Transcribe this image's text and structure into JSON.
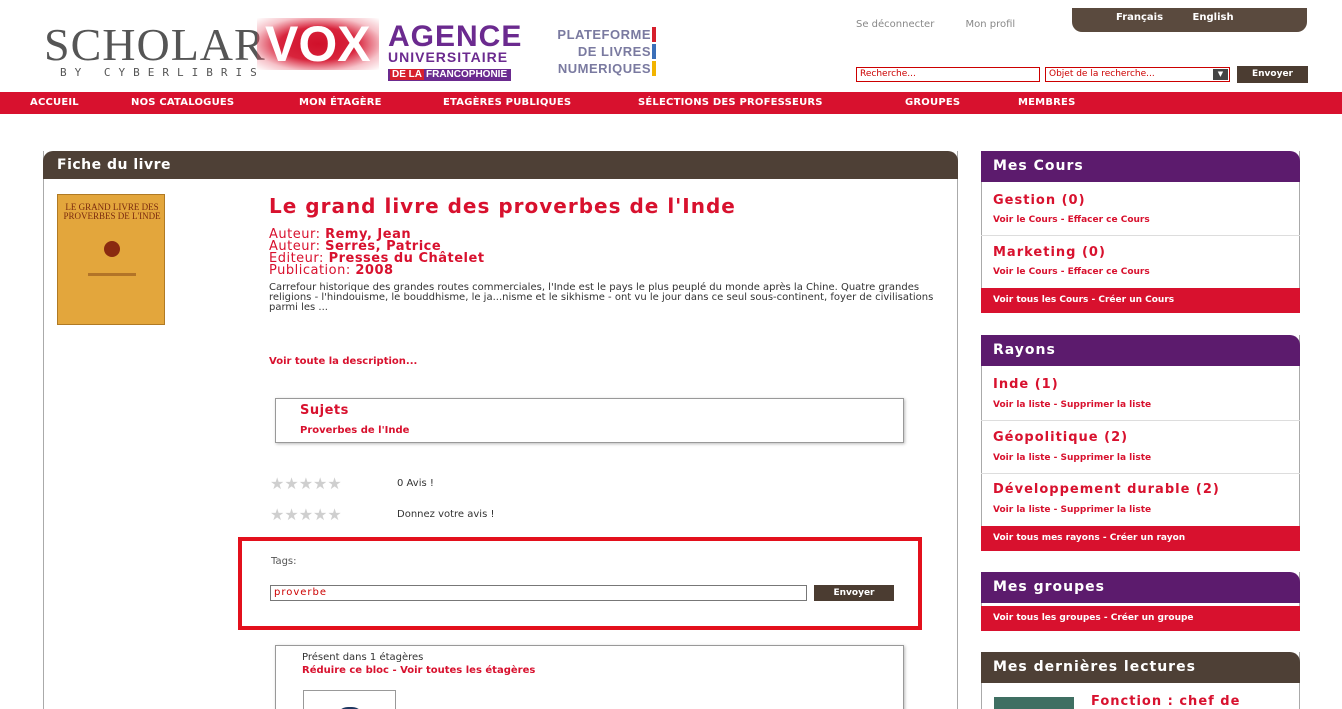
{
  "header": {
    "logo_scholar": "SCHOLAR",
    "logo_vox": "VOX",
    "logo_byline": "BY CYBERLIBRIS",
    "auf_line1": "AGENCE",
    "auf_line2": "UNIVERSITAIRE",
    "auf_line3_prefix": "DE LA",
    "auf_line3": "FRANCOPHONIE",
    "plateforme": [
      "PLATEFORME",
      "DE LIVRES",
      "NUMERIQUES"
    ],
    "logout": "Se déconnecter",
    "profile": "Mon profil",
    "lang_fr": "Français",
    "lang_en": "English",
    "search_placeholder": "Recherche...",
    "search_type": "Objet de la recherche...",
    "search_button": "Envoyer"
  },
  "nav": [
    "ACCUEIL",
    "NOS CATALOGUES",
    "MON ÉTAGÈRE",
    "ETAGÈRES PUBLIQUES",
    "SÉLECTIONS DES PROFESSEURS",
    "GROUPES",
    "MEMBRES"
  ],
  "book": {
    "panel_title": "Fiche du livre",
    "cover_text": "LE GRAND LIVRE DES PROVERBES DE L'INDE",
    "title": "Le grand livre des proverbes de l'Inde",
    "author_label": "Auteur:",
    "authors": [
      "Remy, Jean",
      "Serres, Patrice"
    ],
    "editor_label": "Editeur:",
    "editor": "Presses du Châtelet",
    "publication_label": "Publication:",
    "year": "2008",
    "description": "Carrefour historique des grandes routes commerciales, l'Inde est le pays le plus peuplé du monde après la Chine. Quatre grandes religions - l'hindouisme, le bouddhisme, le ja...nisme et le sikhisme - ont vu le jour dans ce seul sous-continent, foyer de civilisations parmi les ...",
    "description_link": "Voir toute la description...",
    "subjects_title": "Sujets",
    "subject": "Proverbes de l'Inde",
    "rating_count": "0 Avis !",
    "rating_prompt": "Donnez votre avis !",
    "stars": "★★★★★",
    "tags_label": "Tags:",
    "tags_value": "proverbe",
    "tags_button": "Envoyer",
    "shelf_text": "Présent dans 1 étagères",
    "shelf_links": "Réduire ce bloc - Voir toutes les étagères"
  },
  "sidebar": {
    "courses": {
      "title": "Mes Cours",
      "items": [
        {
          "name": "Gestion (0)",
          "links": "Voir le Cours - Effacer ce Cours"
        },
        {
          "name": "Marketing (0)",
          "links": "Voir le Cours - Effacer ce Cours"
        }
      ],
      "footer": "Voir tous les Cours - Créer un Cours"
    },
    "rayons": {
      "title": "Rayons",
      "items": [
        {
          "name": "Inde (1)",
          "links": "Voir la liste - Supprimer la liste"
        },
        {
          "name": "Géopolitique (2)",
          "links": "Voir la liste - Supprimer la liste"
        },
        {
          "name": "Développement durable (2)",
          "links": "Voir la liste - Supprimer la liste"
        }
      ],
      "footer": "Voir tous mes rayons - Créer un rayon"
    },
    "groups": {
      "title": "Mes groupes",
      "footer": "Voir tous les groupes - Créer un groupe"
    },
    "readings": {
      "title": "Mes dernières lectures",
      "item": "Fonction : chef de"
    }
  },
  "colors": {
    "accent_red": "#d8112e",
    "brown": "#4e4036",
    "purple": "#5c1b6d"
  }
}
